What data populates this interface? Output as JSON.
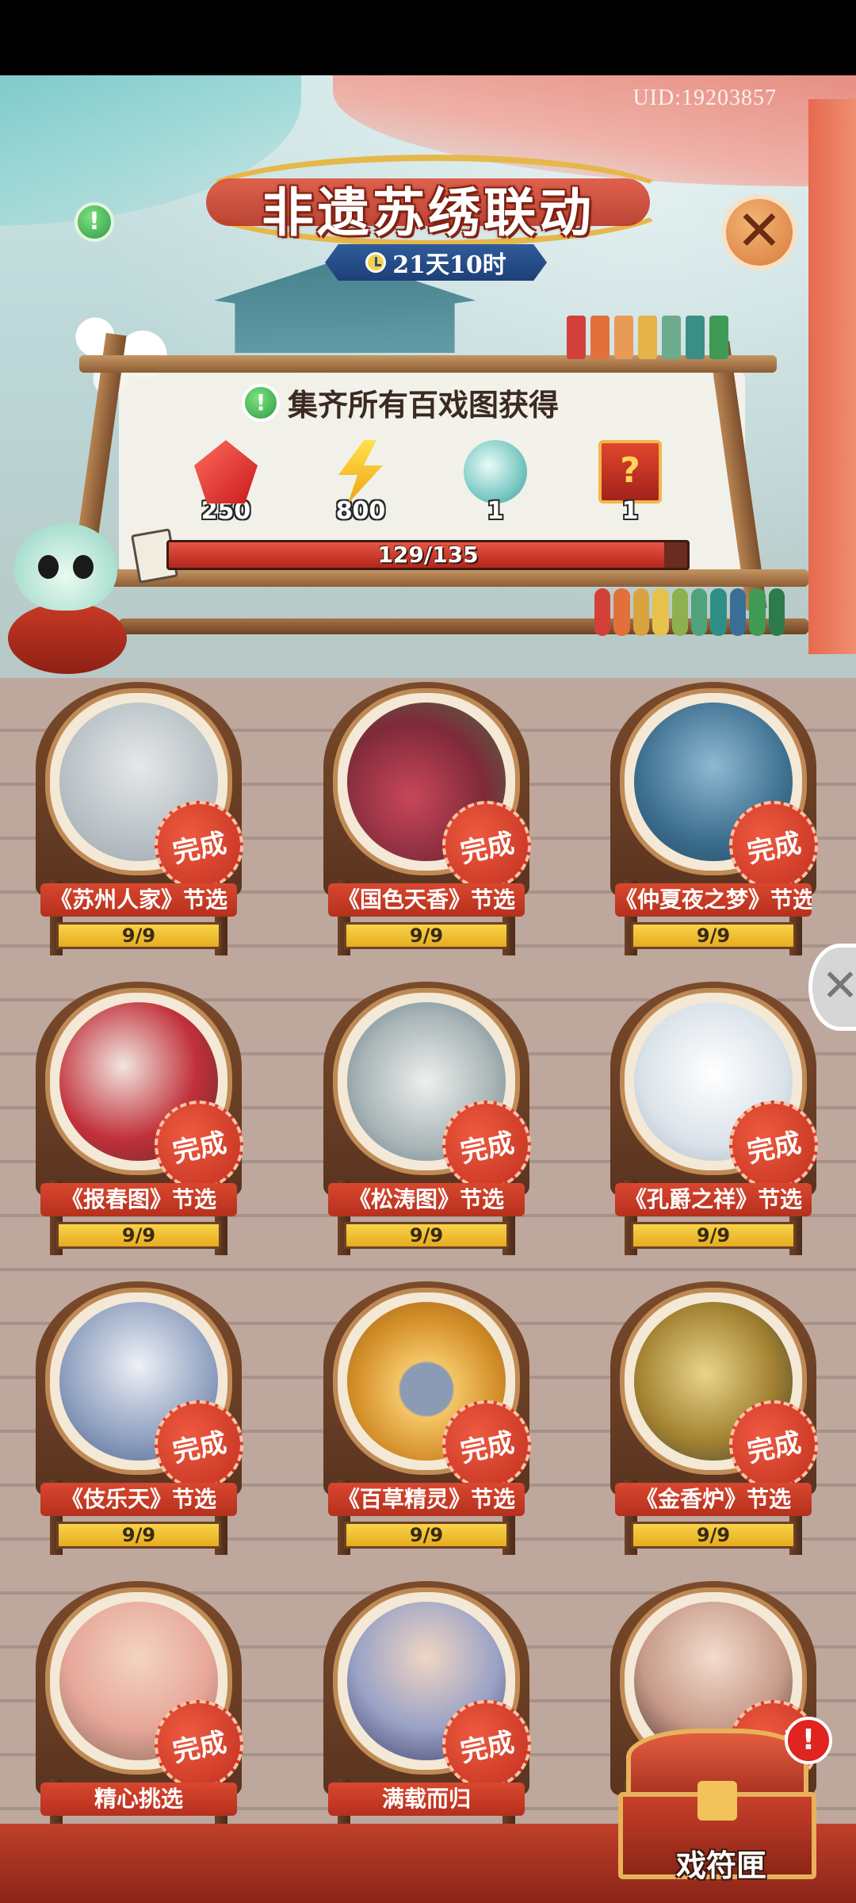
{
  "header": {
    "uid": "UID:19203857",
    "title": "非遗苏绣联动",
    "timer": "21天10时",
    "reward_title": "集齐所有百戏图获得",
    "rewards": [
      {
        "icon": "ruby-icon",
        "count": "250"
      },
      {
        "icon": "lightning-icon",
        "count": "800"
      },
      {
        "icon": "jade-orb-icon",
        "count": "1"
      },
      {
        "icon": "mystery-chest-icon",
        "count": "1"
      }
    ],
    "progress": {
      "text": "129/135",
      "current": 129,
      "total": 135
    }
  },
  "cards": [
    {
      "label": "《苏州人家》节选",
      "stamp": "完成",
      "progress": "9/9",
      "color": "#9aa7ad"
    },
    {
      "label": "《国色天香》节选",
      "stamp": "完成",
      "progress": "9/9",
      "color": "#c8475a"
    },
    {
      "label": "《仲夏夜之梦》节选",
      "stamp": "完成",
      "progress": "9/9",
      "color": "#3d6f8f"
    },
    {
      "label": "《报春图》节选",
      "stamp": "完成",
      "progress": "9/9",
      "color": "#c1303a"
    },
    {
      "label": "《松涛图》节选",
      "stamp": "完成",
      "progress": "9/9",
      "color": "#a8b4b6"
    },
    {
      "label": "《孔爵之祥》节选",
      "stamp": "完成",
      "progress": "9/9",
      "color": "#dbe3ea"
    },
    {
      "label": "《伎乐天》节选",
      "stamp": "完成",
      "progress": "9/9",
      "color": "#8fa0c0"
    },
    {
      "label": "《百草精灵》节选",
      "stamp": "完成",
      "progress": "9/9",
      "color": "#d4902a"
    },
    {
      "label": "《金香炉》节选",
      "stamp": "完成",
      "progress": "9/9",
      "color": "#a38332"
    },
    {
      "label": "精心挑选",
      "stamp": "完成",
      "color": "#e7a79a"
    },
    {
      "label": "满载而归",
      "stamp": "完成",
      "color": "#9aa2c5"
    },
    {
      "label": "",
      "stamp": "完成",
      "color": "#c79a88"
    }
  ],
  "treasure": {
    "label": "戏符匣",
    "alert": "!"
  },
  "icons": {
    "info": "!",
    "close": "✕"
  }
}
